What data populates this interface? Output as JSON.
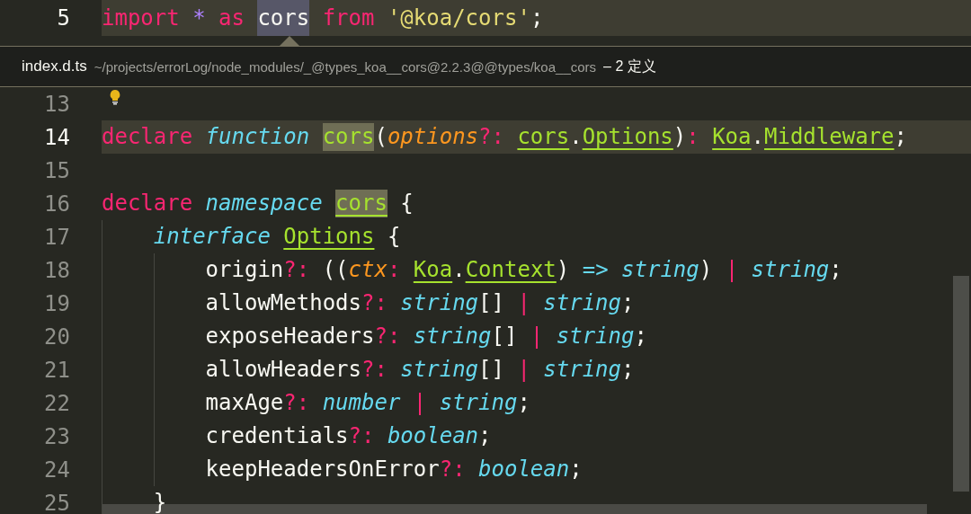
{
  "top_editor": {
    "lines": [
      {
        "number": "5",
        "current": true,
        "tokens": [
          {
            "kind": "keyword",
            "text": "import "
          },
          {
            "kind": "constant",
            "text": "* "
          },
          {
            "kind": "keyword",
            "text": "as "
          },
          {
            "kind": "plain",
            "text": "cors",
            "selected": true
          },
          {
            "kind": "keyword",
            "text": " from "
          },
          {
            "kind": "string",
            "text": "'@koa/cors'"
          },
          {
            "kind": "plain",
            "text": ";"
          }
        ]
      }
    ]
  },
  "peek": {
    "file": "index.d.ts",
    "path": "~/projects/errorLog/node_modules/_@types_koa__cors@2.2.3@@types/koa__cors",
    "count": "– 2 定义"
  },
  "peek_editor": {
    "lines": [
      {
        "number": "13",
        "current": false,
        "lightbulb": true
      },
      {
        "number": "14",
        "current": true,
        "tokens": [
          {
            "kind": "keyword",
            "text": "declare "
          },
          {
            "kind": "storage",
            "text": "function "
          },
          {
            "kind": "entity",
            "text": "cors",
            "highlighted": true
          },
          {
            "kind": "plain",
            "text": "("
          },
          {
            "kind": "parameter",
            "text": "options"
          },
          {
            "kind": "keyword",
            "text": "?: "
          },
          {
            "kind": "entity",
            "text": "cors",
            "underlined": true
          },
          {
            "kind": "plain",
            "text": "."
          },
          {
            "kind": "entity",
            "text": "Options",
            "underlined": true
          },
          {
            "kind": "plain",
            "text": ")"
          },
          {
            "kind": "keyword",
            "text": ": "
          },
          {
            "kind": "entity",
            "text": "Koa",
            "underlined": true
          },
          {
            "kind": "plain",
            "text": "."
          },
          {
            "kind": "entity",
            "text": "Middleware",
            "underlined": true
          },
          {
            "kind": "plain",
            "text": ";"
          }
        ]
      },
      {
        "number": "15",
        "current": false
      },
      {
        "number": "16",
        "current": false,
        "tokens": [
          {
            "kind": "keyword",
            "text": "declare "
          },
          {
            "kind": "storage",
            "text": "namespace "
          },
          {
            "kind": "entity",
            "text": "cors",
            "highlighted": true,
            "underlined": true
          },
          {
            "kind": "plain",
            "text": " {"
          }
        ],
        "children": [
          {
            "number": "17",
            "current": false,
            "tokens": [
              {
                "kind": "storage",
                "text": "interface "
              },
              {
                "kind": "entity",
                "text": "Options",
                "underlined": true
              },
              {
                "kind": "plain",
                "text": " {"
              }
            ],
            "children": [
              {
                "number": "18",
                "current": false,
                "tokens": [
                  {
                    "kind": "plain",
                    "text": "origin"
                  },
                  {
                    "kind": "keyword",
                    "text": "?: "
                  },
                  {
                    "kind": "plain",
                    "text": "(("
                  },
                  {
                    "kind": "parameter",
                    "text": "ctx"
                  },
                  {
                    "kind": "keyword",
                    "text": ": "
                  },
                  {
                    "kind": "entity",
                    "text": "Koa",
                    "underlined": true
                  },
                  {
                    "kind": "plain",
                    "text": "."
                  },
                  {
                    "kind": "entity",
                    "text": "Context",
                    "underlined": true
                  },
                  {
                    "kind": "plain",
                    "text": ") "
                  },
                  {
                    "kind": "storage_plain",
                    "text": "=> "
                  },
                  {
                    "kind": "storage",
                    "text": "string"
                  },
                  {
                    "kind": "plain",
                    "text": ") "
                  },
                  {
                    "kind": "keyword",
                    "text": "| "
                  },
                  {
                    "kind": "storage",
                    "text": "string"
                  },
                  {
                    "kind": "plain",
                    "text": ";"
                  }
                ]
              },
              {
                "number": "19",
                "current": false,
                "tokens": [
                  {
                    "kind": "plain",
                    "text": "allowMethods"
                  },
                  {
                    "kind": "keyword",
                    "text": "?: "
                  },
                  {
                    "kind": "storage",
                    "text": "string"
                  },
                  {
                    "kind": "plain",
                    "text": "[] "
                  },
                  {
                    "kind": "keyword",
                    "text": "| "
                  },
                  {
                    "kind": "storage",
                    "text": "string"
                  },
                  {
                    "kind": "plain",
                    "text": ";"
                  }
                ]
              },
              {
                "number": "20",
                "current": false,
                "tokens": [
                  {
                    "kind": "plain",
                    "text": "exposeHeaders"
                  },
                  {
                    "kind": "keyword",
                    "text": "?: "
                  },
                  {
                    "kind": "storage",
                    "text": "string"
                  },
                  {
                    "kind": "plain",
                    "text": "[] "
                  },
                  {
                    "kind": "keyword",
                    "text": "| "
                  },
                  {
                    "kind": "storage",
                    "text": "string"
                  },
                  {
                    "kind": "plain",
                    "text": ";"
                  }
                ]
              },
              {
                "number": "21",
                "current": false,
                "tokens": [
                  {
                    "kind": "plain",
                    "text": "allowHeaders"
                  },
                  {
                    "kind": "keyword",
                    "text": "?: "
                  },
                  {
                    "kind": "storage",
                    "text": "string"
                  },
                  {
                    "kind": "plain",
                    "text": "[] "
                  },
                  {
                    "kind": "keyword",
                    "text": "| "
                  },
                  {
                    "kind": "storage",
                    "text": "string"
                  },
                  {
                    "kind": "plain",
                    "text": ";"
                  }
                ]
              },
              {
                "number": "22",
                "current": false,
                "tokens": [
                  {
                    "kind": "plain",
                    "text": "maxAge"
                  },
                  {
                    "kind": "keyword",
                    "text": "?: "
                  },
                  {
                    "kind": "storage",
                    "text": "number "
                  },
                  {
                    "kind": "keyword",
                    "text": "| "
                  },
                  {
                    "kind": "storage",
                    "text": "string"
                  },
                  {
                    "kind": "plain",
                    "text": ";"
                  }
                ]
              },
              {
                "number": "23",
                "current": false,
                "tokens": [
                  {
                    "kind": "plain",
                    "text": "credentials"
                  },
                  {
                    "kind": "keyword",
                    "text": "?: "
                  },
                  {
                    "kind": "storage",
                    "text": "boolean"
                  },
                  {
                    "kind": "plain",
                    "text": ";"
                  }
                ]
              },
              {
                "number": "24",
                "current": false,
                "tokens": [
                  {
                    "kind": "plain",
                    "text": "keepHeadersOnError"
                  },
                  {
                    "kind": "keyword",
                    "text": "?: "
                  },
                  {
                    "kind": "storage",
                    "text": "boolean"
                  },
                  {
                    "kind": "plain",
                    "text": ";"
                  }
                ]
              }
            ]
          },
          {
            "number": "25",
            "current": false,
            "tokens": [
              {
                "kind": "plain",
                "text": "}"
              }
            ]
          }
        ]
      }
    ]
  }
}
